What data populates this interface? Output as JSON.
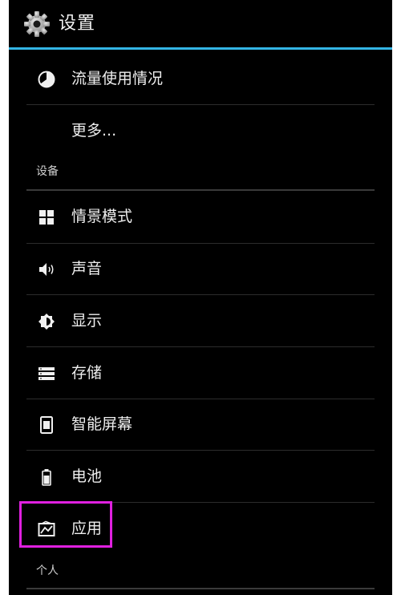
{
  "header": {
    "title": "设置",
    "icon": "settings-gear-icon"
  },
  "items": {
    "data_usage": {
      "label": "流量使用情况",
      "icon": "data-usage-icon"
    },
    "more": {
      "label": "更多..."
    },
    "section_device": {
      "label": "设备"
    },
    "profiles": {
      "label": "情景模式",
      "icon": "profiles-icon"
    },
    "sound": {
      "label": "声音",
      "icon": "sound-icon"
    },
    "display": {
      "label": "显示",
      "icon": "display-brightness-icon"
    },
    "storage": {
      "label": "存储",
      "icon": "storage-icon"
    },
    "smart_screen": {
      "label": "智能屏幕",
      "icon": "smart-screen-icon"
    },
    "battery": {
      "label": "电池",
      "icon": "battery-icon"
    },
    "apps": {
      "label": "应用",
      "icon": "apps-icon"
    },
    "section_personal": {
      "label": "个人"
    }
  },
  "colors": {
    "accent": "#33b5e5",
    "highlight": "#e020e0",
    "background": "#000000",
    "text": "#eeeeee"
  }
}
